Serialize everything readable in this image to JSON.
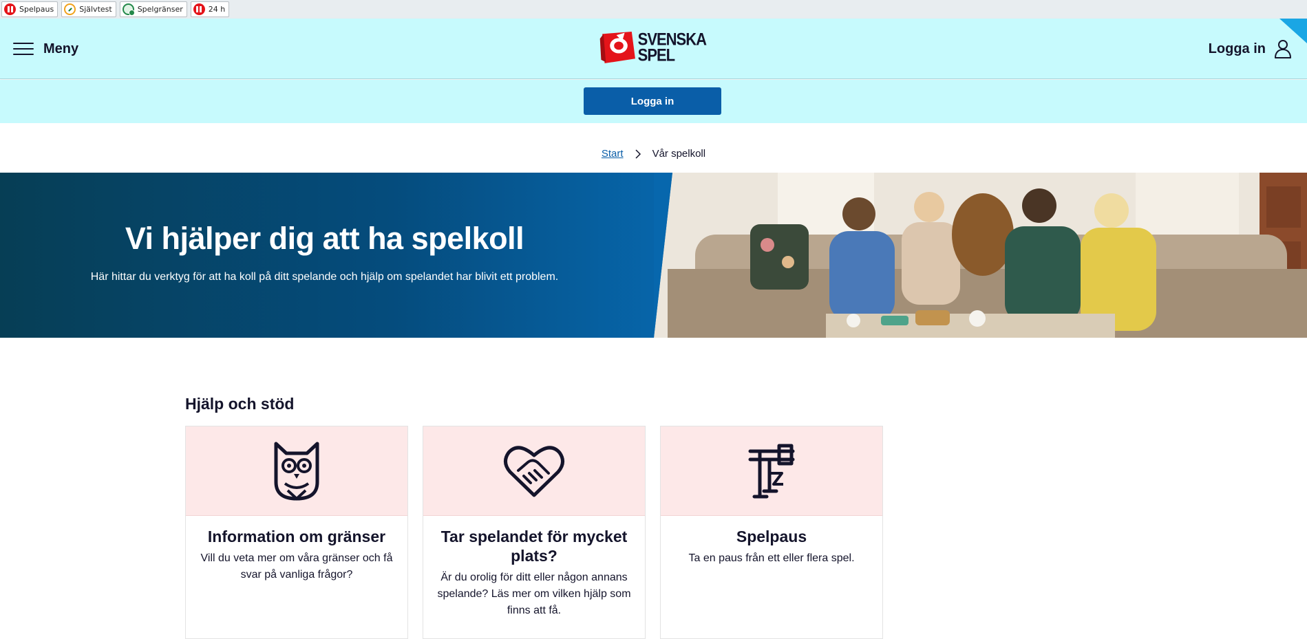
{
  "utility_bar": {
    "items": [
      {
        "label": "Spelpaus",
        "icon": "pause-icon"
      },
      {
        "label": "Självtest",
        "icon": "self-test-icon"
      },
      {
        "label": "Spelgränser",
        "icon": "limits-icon"
      },
      {
        "label": "24 h",
        "icon": "pause-icon"
      }
    ]
  },
  "header": {
    "menu_label": "Meny",
    "logo_text_line1": "SVENSKA",
    "logo_text_line2": "SPEL",
    "login_label": "Logga in"
  },
  "login_band": {
    "button_label": "Logga in"
  },
  "breadcrumb": {
    "start": "Start",
    "current": "Vår spelkoll"
  },
  "hero": {
    "title": "Vi hjälper dig att ha spelkoll",
    "subtitle": "Här hittar du verktyg för att ha koll på ditt spelande och hjälp om spelandet har blivit ett problem."
  },
  "help_section": {
    "title": "Hjälp och stöd",
    "cards": [
      {
        "icon": "owl-icon",
        "title": "Information om gränser",
        "description": "Vill du veta mer om våra gränser och få svar på vanliga frågor?"
      },
      {
        "icon": "heart-handshake-icon",
        "title": "Tar spelandet för mycket plats?",
        "description": "Är du orolig för ditt eller någon annans spelande? Läs mer om vilken hjälp som finns att få."
      },
      {
        "icon": "pause-stamp-icon",
        "title": "Spelpaus",
        "description": "Ta en paus från ett eller flera spel."
      }
    ]
  },
  "colors": {
    "header_bg": "#c7fafd",
    "primary_button": "#0a5ea8",
    "brand_red": "#e4141a",
    "card_top_bg": "#fde8e8",
    "hero_blue": "#0767ad"
  }
}
